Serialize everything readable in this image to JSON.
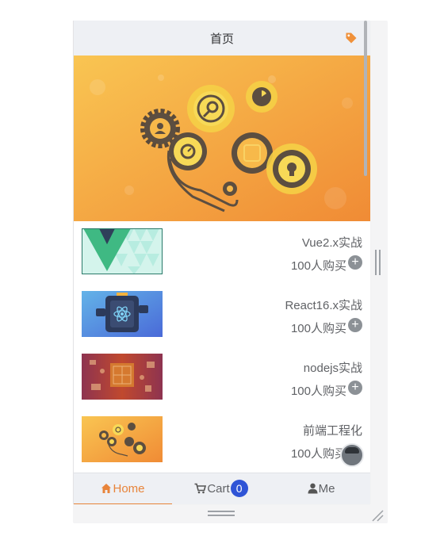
{
  "header": {
    "title": "首页",
    "tag_icon": "tag-icon",
    "accent_color": "#f0913a"
  },
  "banner": {
    "image": "gears-illustration"
  },
  "products": [
    {
      "title": "Vue2.x实战",
      "buyers": "100人购买",
      "thumb": "vue-logo"
    },
    {
      "title": "React16.x实战",
      "buyers": "100人购买",
      "thumb": "react-illustration"
    },
    {
      "title": "nodejs实战",
      "buyers": "100人购买",
      "thumb": "nodejs-illustration"
    },
    {
      "title": "前端工程化",
      "buyers": "100人购买",
      "thumb": "gears-illustration"
    }
  ],
  "add_button": "+",
  "tabbar": {
    "tabs": [
      {
        "label": "Home",
        "icon": "home-icon",
        "active": true
      },
      {
        "label": "Cart",
        "icon": "cart-icon",
        "badge": "0"
      },
      {
        "label": "Me",
        "icon": "user-icon"
      }
    ],
    "active_color": "#e8843a",
    "badge_color": "#2f54d6"
  }
}
